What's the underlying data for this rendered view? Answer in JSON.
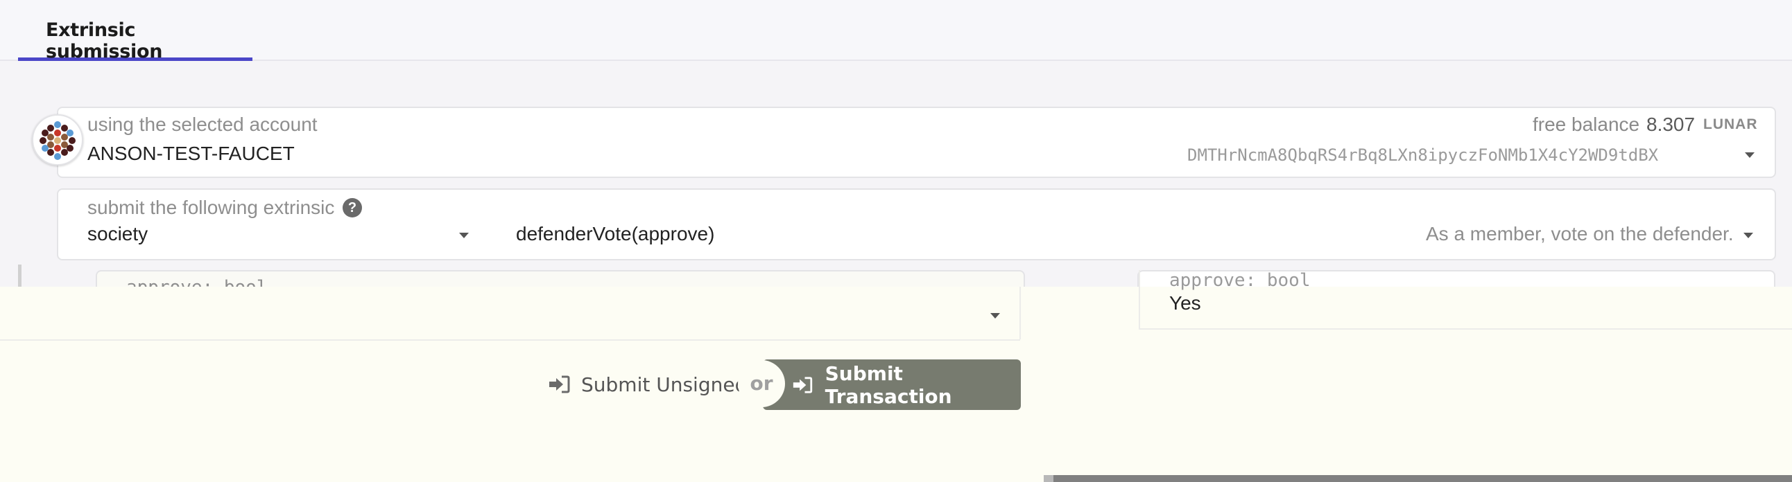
{
  "tabs": [
    {
      "label": "Extrinsic submission"
    }
  ],
  "account": {
    "label": "using the selected account",
    "name": "ANSON-TEST-FAUCET",
    "balance_label": "free balance",
    "balance_value": "8.307",
    "balance_unit": "LUNAR",
    "address": "DMTHrNcmA8QbqRS4rBq8LXn8ipyczFoNMb1X4cY2WD9tdBX"
  },
  "extrinsic": {
    "label": "submit the following extrinsic",
    "help_icon": "help-circle-icon",
    "section": "society",
    "method": "defenderVote(approve)",
    "description": "As a member, vote on the defender."
  },
  "param": {
    "label": "approve: bool",
    "value": "Yes"
  },
  "actions": {
    "unsigned_label": "Submit Unsigned",
    "or_label": "or",
    "sign_label": "Submit Transaction",
    "sign_icon": "sign-in-icon"
  },
  "colors": {
    "accent": "#4b46c8",
    "primary_button": "#777b6f",
    "overlay": "#fdfdf4"
  }
}
